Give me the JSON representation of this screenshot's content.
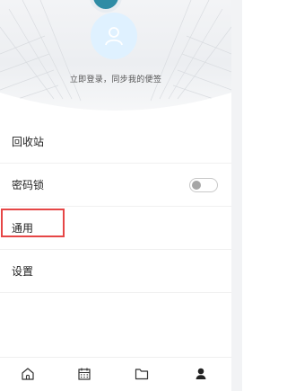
{
  "profile": {
    "login_prompt": "立即登录，同步我的便签"
  },
  "menu": {
    "items": [
      {
        "label": "回收站"
      },
      {
        "label": "密码锁",
        "toggle_on": false
      },
      {
        "label": "通用"
      },
      {
        "label": "设置"
      }
    ]
  },
  "bottom_nav": {
    "items": [
      {
        "icon": "home-icon"
      },
      {
        "icon": "calendar-icon"
      },
      {
        "icon": "folder-icon"
      },
      {
        "icon": "person-icon",
        "active": true
      }
    ]
  },
  "colors": {
    "highlight_border": "#e64646",
    "avatar_bg": "#dff1ff",
    "top_icon": "#2f8ca5"
  }
}
